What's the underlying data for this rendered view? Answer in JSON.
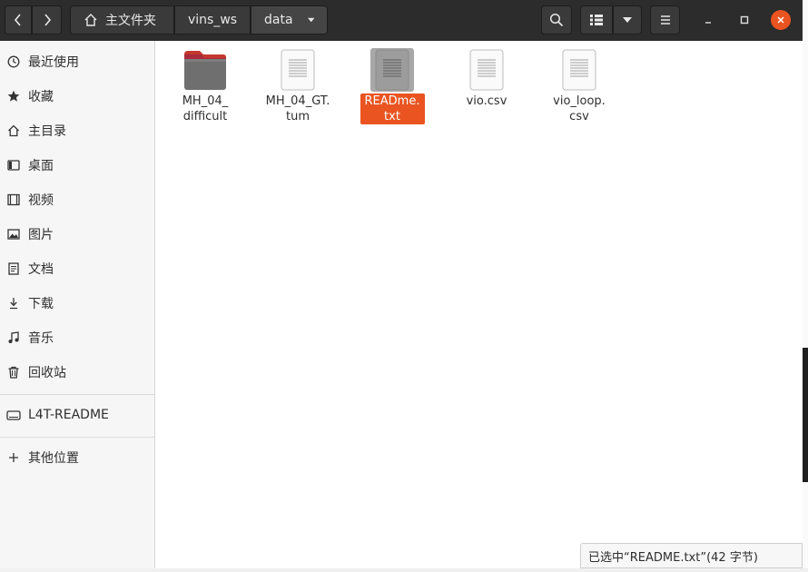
{
  "header": {
    "back_icon": "chevron-left-icon",
    "forward_icon": "chevron-right-icon",
    "breadcrumbs": [
      {
        "label": "主文件夹",
        "icon": "home-icon"
      },
      {
        "label": "vins_ws"
      },
      {
        "label": "data"
      }
    ],
    "search_icon": "search-icon",
    "view_icon": "list-view-icon",
    "menu_icon": "hamburger-icon",
    "window_controls": [
      "minimize",
      "maximize",
      "close"
    ]
  },
  "sidebar": {
    "items": [
      {
        "label": "最近使用",
        "icon": "clock-icon"
      },
      {
        "label": "收藏",
        "icon": "star-icon"
      },
      {
        "label": "主目录",
        "icon": "home-icon"
      },
      {
        "label": "桌面",
        "icon": "desktop-icon"
      },
      {
        "label": "视频",
        "icon": "video-icon"
      },
      {
        "label": "图片",
        "icon": "image-icon"
      },
      {
        "label": "文档",
        "icon": "document-icon"
      },
      {
        "label": "下载",
        "icon": "download-icon"
      },
      {
        "label": "音乐",
        "icon": "music-icon"
      },
      {
        "label": "回收站",
        "icon": "trash-icon"
      }
    ],
    "devices": [
      {
        "label": "L4T-README",
        "icon": "drive-icon"
      }
    ],
    "other": {
      "label": "其他位置",
      "icon": "plus-icon"
    }
  },
  "files": [
    {
      "name": "MH_04_difficult",
      "line1": "MH_04_",
      "line2": "difficult",
      "type": "folder"
    },
    {
      "name": "MH_04_GT.tum",
      "line1": "MH_04_GT.",
      "line2": "tum",
      "type": "text"
    },
    {
      "name": "README.txt",
      "line1": "READme.",
      "line2": "txt",
      "type": "text",
      "selected": true
    },
    {
      "name": "vio.csv",
      "line1": "vio.csv",
      "line2": "",
      "type": "text"
    },
    {
      "name": "vio_loop.csv",
      "line1": "vio_loop.",
      "line2": "csv",
      "type": "text"
    }
  ],
  "status": {
    "text": "已选中“README.txt”(42 字节)"
  },
  "colors": {
    "accent": "#e95420",
    "header": "#2c2c2c",
    "sidebar": "#f6f6f6"
  }
}
